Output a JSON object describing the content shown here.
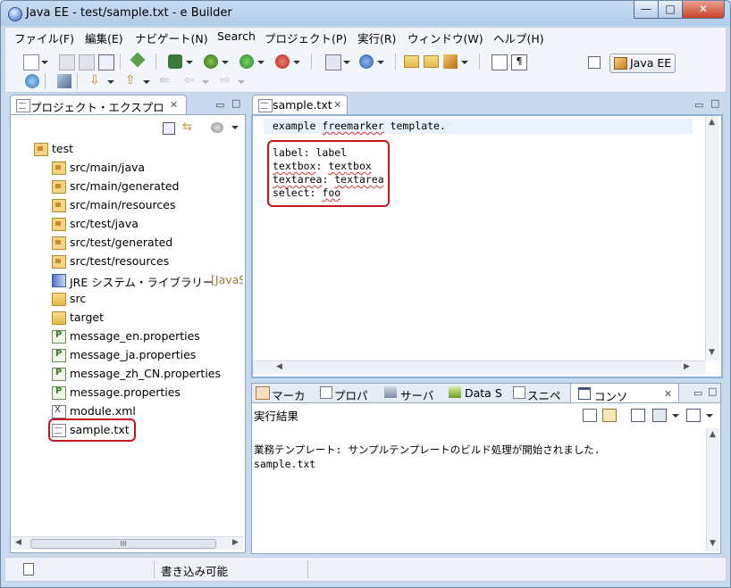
{
  "window": {
    "title": "Java EE - test/sample.txt - e Builder",
    "buttons": {
      "minimize": "—",
      "maximize": "□",
      "close": "✕"
    }
  },
  "menu": [
    "ファイル(F)",
    "編集(E)",
    "ナビゲート(N)",
    "Search",
    "プロジェクト(P)",
    "実行(R)",
    "ウィンドウ(W)",
    "ヘルプ(H)"
  ],
  "perspective": {
    "label": "Java EE"
  },
  "explorer": {
    "tab_label": "プロジェクト・エクスプロ",
    "project": "test",
    "items": [
      {
        "label": "src/main/java",
        "icon": "package-folder-icon"
      },
      {
        "label": "src/main/generated",
        "icon": "package-folder-icon"
      },
      {
        "label": "src/main/resources",
        "icon": "package-folder-icon"
      },
      {
        "label": "src/test/java",
        "icon": "package-folder-icon"
      },
      {
        "label": "src/test/generated",
        "icon": "package-folder-icon"
      },
      {
        "label": "src/test/resources",
        "icon": "package-folder-icon"
      },
      {
        "label": "JRE システム・ライブラリー",
        "suffix": "[JavaS",
        "icon": "library-icon"
      },
      {
        "label": "src",
        "icon": "folder-icon"
      },
      {
        "label": "target",
        "icon": "folder-icon"
      },
      {
        "label": "message_en.properties",
        "icon": "properties-file-icon"
      },
      {
        "label": "message_ja.properties",
        "icon": "properties-file-icon"
      },
      {
        "label": "message_zh_CN.properties",
        "icon": "properties-file-icon"
      },
      {
        "label": "message.properties",
        "icon": "properties-file-icon"
      },
      {
        "label": "module.xml",
        "icon": "xml-file-icon"
      },
      {
        "label": "sample.txt",
        "icon": "text-file-icon"
      }
    ],
    "hscroll_thumb": "III"
  },
  "editor": {
    "tab_label": "sample.txt",
    "lines": [
      {
        "key": "example",
        "sep": " ",
        "value": "freemarker",
        "rest": " template."
      },
      {
        "key": "label",
        "sep": ": ",
        "value": "label",
        "rest": ""
      },
      {
        "key": "textbox",
        "sep": ": ",
        "value": "textbox",
        "rest": ""
      },
      {
        "key": "textarea",
        "sep": ": ",
        "value": "textarea",
        "rest": ""
      },
      {
        "key": "select",
        "sep": ": ",
        "value": "foo",
        "rest": ""
      }
    ]
  },
  "bottom": {
    "tabs": [
      "マーカ",
      "プロパ",
      "サーバ",
      "Data S",
      "スニペ",
      "コンソ"
    ],
    "heading": "実行結果",
    "console_lines": [
      "業務テンプレート: サンプルテンプレートのビルド処理が開始されました.",
      "sample.txt"
    ]
  },
  "status": {
    "writable": "書き込み可能"
  },
  "colors": {
    "highlight": "#c8141c",
    "selection": "#dbe7f7"
  }
}
